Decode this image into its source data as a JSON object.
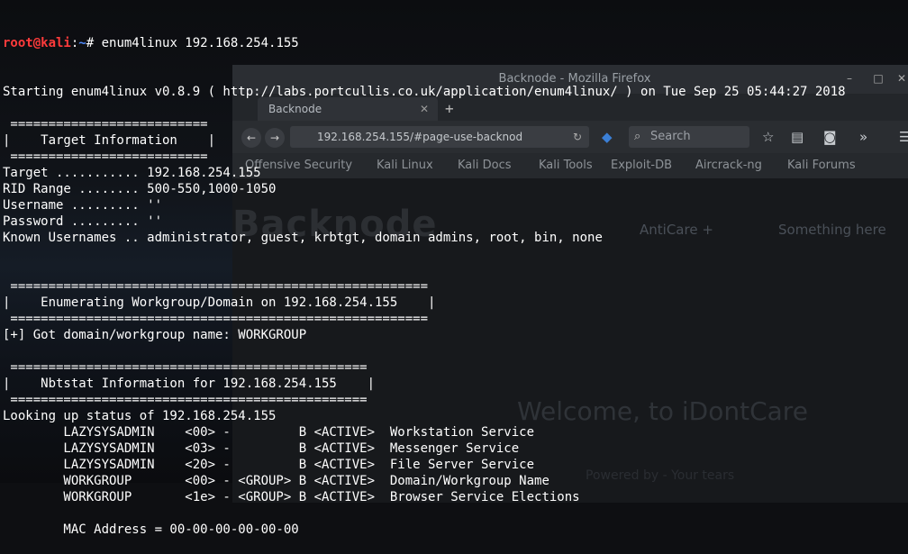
{
  "firefox": {
    "title": "Backnode - Mozilla Firefox",
    "tab_label": "Backnode",
    "tab_close": "✕",
    "new_tab": "+",
    "url": "192.168.254.155/#page-use-backnod",
    "search_placeholder": "Search",
    "bookmarks": [
      "Offensive Security",
      "Kali Linux",
      "Kali Docs",
      "Kali Tools",
      "Exploit-DB",
      "Aircrack-ng",
      "Kali Forums"
    ],
    "page": {
      "logo": "Backnode",
      "menu": [
        "AntiCare +",
        "Something here"
      ],
      "welcome": "Welcome, to iDontCare",
      "powered": "Powered by - Your tears"
    }
  },
  "terminal": {
    "prompt_user": "root@kali",
    "prompt_sep": ":",
    "prompt_path": "~",
    "prompt_suffix": "# enum4linux 192.168.254.155",
    "lines": [
      "Starting enum4linux v0.8.9 ( http://labs.portcullis.co.uk/application/enum4linux/ ) on Tue Sep 25 05:44:27 2018",
      "",
      " ==========================",
      "|    Target Information    |",
      " ==========================",
      "Target ........... 192.168.254.155",
      "RID Range ........ 500-550,1000-1050",
      "Username ......... ''",
      "Password ......... ''",
      "Known Usernames .. administrator, guest, krbtgt, domain admins, root, bin, none",
      "",
      "",
      " =======================================================",
      "|    Enumerating Workgroup/Domain on 192.168.254.155    |",
      " =======================================================",
      "[+] Got domain/workgroup name: WORKGROUP",
      "",
      " ===============================================",
      "|    Nbtstat Information for 192.168.254.155    |",
      " ===============================================",
      "Looking up status of 192.168.254.155",
      "        LAZYSYSADMIN    <00> -         B <ACTIVE>  Workstation Service",
      "        LAZYSYSADMIN    <03> -         B <ACTIVE>  Messenger Service",
      "        LAZYSYSADMIN    <20> -         B <ACTIVE>  File Server Service",
      "        WORKGROUP       <00> - <GROUP> B <ACTIVE>  Domain/Workgroup Name",
      "        WORKGROUP       <1e> - <GROUP> B <ACTIVE>  Browser Service Elections",
      "",
      "        MAC Address = 00-00-00-00-00-00"
    ]
  }
}
